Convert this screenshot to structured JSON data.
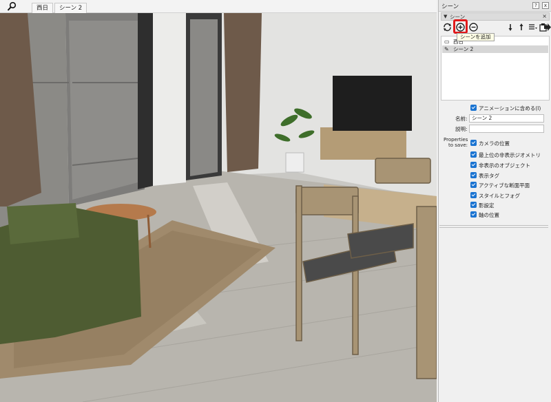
{
  "tabs": [
    {
      "label": "西日"
    },
    {
      "label": "シーン 2"
    }
  ],
  "panel": {
    "title": "シーン",
    "section_label": "シーン",
    "close_glyph": "×",
    "pin_glyph": "?",
    "x_glyph": "x",
    "tooltip": "シーンを追加",
    "scenes": [
      {
        "name": "西日"
      },
      {
        "name": "シーン 2"
      }
    ],
    "include_animation": "アニメーションに含める(I)",
    "name_label": "名前:",
    "name_value": "シーン 2",
    "desc_label": "説明:",
    "desc_value": "",
    "properties_label_1": "Properties",
    "properties_label_2": "to save:",
    "properties": [
      {
        "label": "カメラの位置"
      },
      {
        "label": "最上位の非表示ジオメトリ"
      },
      {
        "label": "非表示のオブジェクト"
      },
      {
        "label": "表示タグ"
      },
      {
        "label": "アクティブな断面平面"
      },
      {
        "label": "スタイルとフォグ"
      },
      {
        "label": "影設定"
      },
      {
        "label": "軸の位置"
      }
    ]
  },
  "colors": {
    "highlight": "#e11a1a",
    "checkbox": "#1a73d1",
    "sofa": "#4e5c32",
    "floor": "#b7b4ad",
    "rug": "#a18a6c",
    "wood": "#b09a78"
  }
}
